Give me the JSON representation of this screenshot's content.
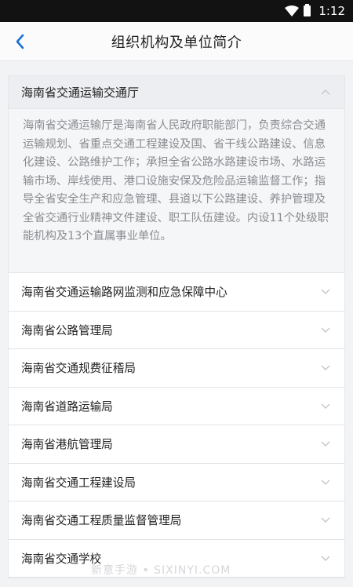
{
  "status_bar": {
    "time": "1:12"
  },
  "header": {
    "title": "组织机构及单位简介"
  },
  "expanded_section": {
    "name": "海南省交通运输交通厅",
    "description": "海南省交通运输厅是海南省人民政府职能部门，负责综合交通运输规划、省重点交通工程建设及国、省干线公路建设、信息化建设、公路维护工作；承担全省公路水路建设市场、水路运输市场、岸线使用、港口设施安保及危险品运输监督工作；指导全省安全生产和应急管理、县道以下公路建设、养护管理及全省交通行业精神文件建设、职工队伍建设。内设11个处级职能机构及13个直属事业单位。"
  },
  "items": [
    {
      "name": "海南省交通运输路网监测和应急保障中心"
    },
    {
      "name": "海南省公路管理局"
    },
    {
      "name": "海南省交通规费征稽局"
    },
    {
      "name": "海南省道路运输局"
    },
    {
      "name": "海南省港航管理局"
    },
    {
      "name": "海南省交通工程建设局"
    },
    {
      "name": "海南省交通工程质量监督管理局"
    },
    {
      "name": "海南省交通学校"
    }
  ],
  "watermark": "新意手游 • SIXINYI.COM",
  "colors": {
    "chevron": "#c5c7cb",
    "accent": "#1a6fd6"
  }
}
